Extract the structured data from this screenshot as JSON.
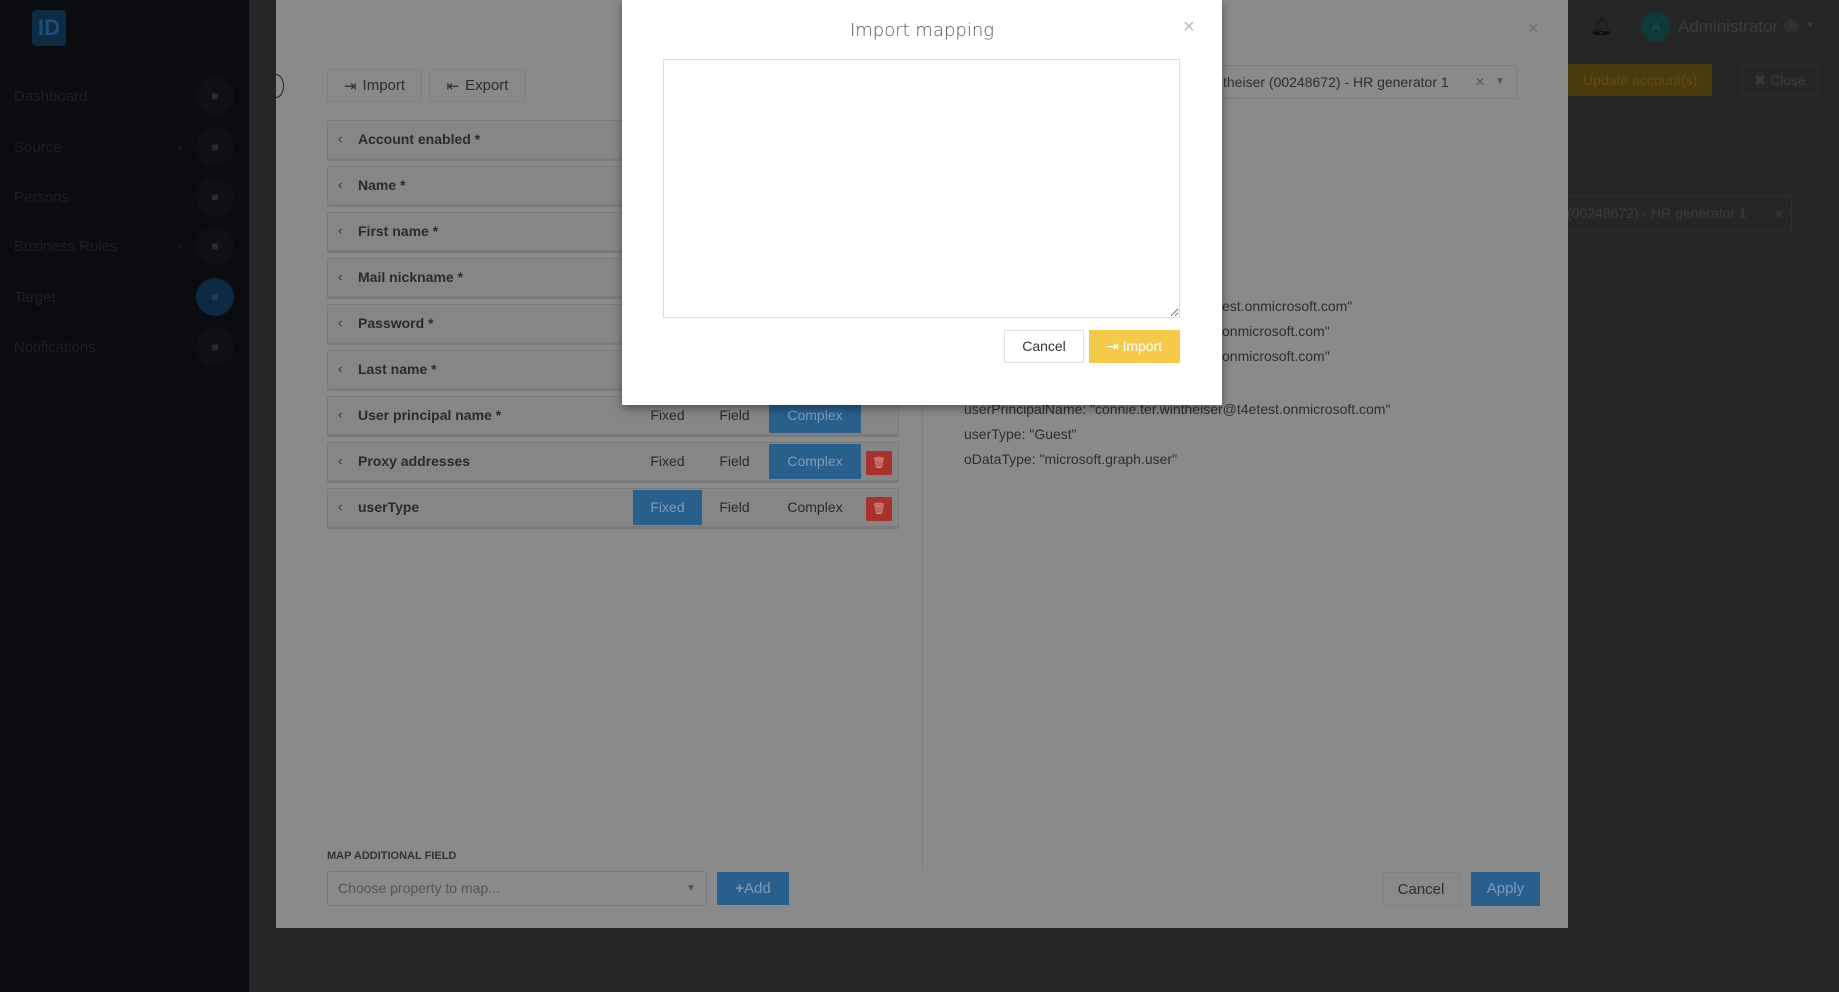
{
  "sidebar": {
    "logo": "ID",
    "items": [
      {
        "label": "Dashboard",
        "icon": "home-icon"
      },
      {
        "label": "Source",
        "icon": "layers-icon",
        "has_submenu": true
      },
      {
        "label": "Persons",
        "icon": "users-icon"
      },
      {
        "label": "Business Rules",
        "icon": "globe-icon",
        "has_submenu": true
      },
      {
        "label": "Target",
        "icon": "grid-icon",
        "active": true
      },
      {
        "label": "Notifications",
        "icon": "envelope-icon"
      }
    ]
  },
  "topbar": {
    "user": "Administrator",
    "avatar_initial": "A",
    "badge": "!",
    "update_button": "Update account(s)",
    "close_button": "Close",
    "person_select": "(00248672) - HR generator 1"
  },
  "mapping": {
    "import_label": "Import",
    "export_label": "Export",
    "person_select": "theiser (00248672) - HR generator 1",
    "rows": [
      {
        "label": "Account enabled *"
      },
      {
        "label": "Name *"
      },
      {
        "label": "First name *"
      },
      {
        "label": "Mail nickname *"
      },
      {
        "label": "Password *"
      },
      {
        "label": "Last name *"
      },
      {
        "label": "User principal name *",
        "mode": "Complex",
        "deletable": false
      },
      {
        "label": "Proxy addresses",
        "mode": "Complex",
        "deletable": true
      },
      {
        "label": "userType",
        "mode": "Fixed",
        "deletable": true
      }
    ],
    "modes": [
      "Fixed",
      "Field",
      "Complex"
    ],
    "preview_lines": [
      "est.onmicrosoft.com\"",
      "onmicrosoft.com\"",
      "onmicrosoft.com\"",
      "userPrincipalName: \"connie.ter.wintheiser@t4etest.onmicrosoft.com\"",
      "userType: \"Guest\"",
      "oDataType: \"microsoft.graph.user\""
    ],
    "additional_label": "MAP ADDITIONAL FIELD",
    "additional_placeholder": "Choose property to map...",
    "add_button": "Add",
    "cancel_button": "Cancel",
    "apply_button": "Apply"
  },
  "modal": {
    "title": "Import mapping",
    "textarea_value": "",
    "cancel": "Cancel",
    "import": "Import",
    "colors": {
      "import": "#f5c94a"
    }
  }
}
